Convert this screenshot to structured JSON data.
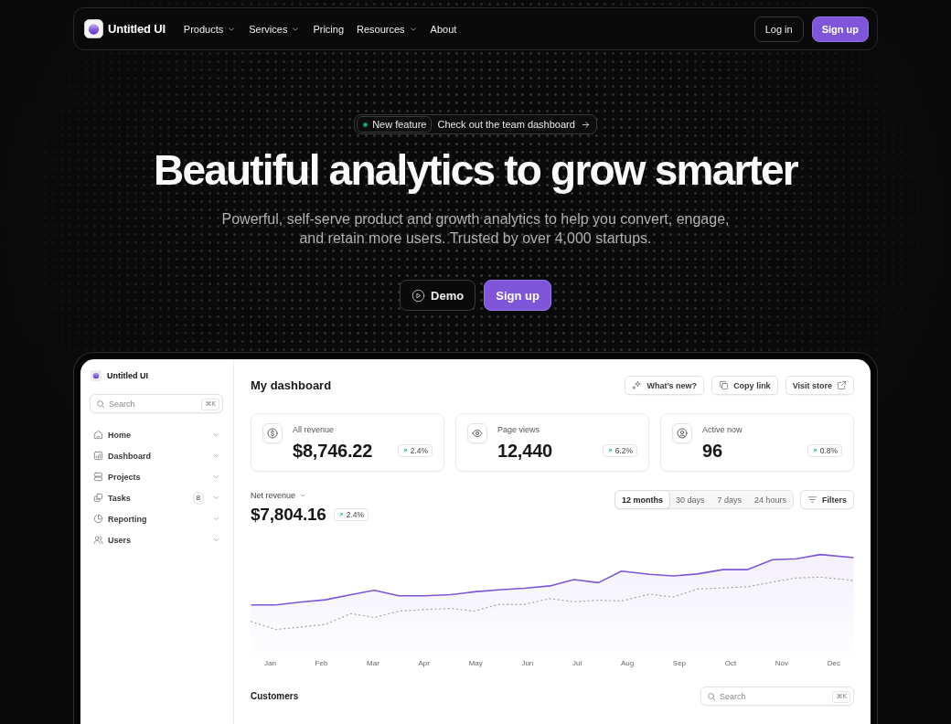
{
  "nav": {
    "brand": "Untitled UI",
    "links": [
      {
        "label": "Products",
        "kind": "dropdown"
      },
      {
        "label": "Services",
        "kind": "dropdown"
      },
      {
        "label": "Pricing",
        "kind": "link"
      },
      {
        "label": "Resources",
        "kind": "dropdown"
      },
      {
        "label": "About",
        "kind": "link"
      }
    ],
    "login": "Log in",
    "signup": "Sign up"
  },
  "hero": {
    "announcement": {
      "tag": "New feature",
      "text": "Check out the team dashboard"
    },
    "title": "Beautiful analytics to grow smarter",
    "subtitle": "Powerful, self-serve product and growth analytics to help you convert, engage, and retain more users. Trusted by over 4,000 startups.",
    "buttons": [
      {
        "label": "Demo",
        "kind": "secondary"
      },
      {
        "label": "Sign up",
        "kind": "primary"
      }
    ]
  },
  "dashboard": {
    "sidebar": {
      "brand": "Untitled UI",
      "search": {
        "placeholder": "Search",
        "shortcut": "⌘K"
      },
      "items": [
        {
          "label": "Home"
        },
        {
          "label": "Dashboard"
        },
        {
          "label": "Projects"
        },
        {
          "label": "Tasks",
          "badge": "8"
        },
        {
          "label": "Reporting"
        },
        {
          "label": "Users"
        }
      ]
    },
    "title": "My dashboard",
    "actions": [
      {
        "label": "What’s new?"
      },
      {
        "label": "Copy link"
      },
      {
        "label": "Visit store"
      }
    ],
    "stats": [
      {
        "label": "All revenue",
        "value": "$8,746.22",
        "change": "2.4%"
      },
      {
        "label": "Page views",
        "value": "12,440",
        "change": "6.2%"
      },
      {
        "label": "Active now",
        "value": "96",
        "change": "0.8%"
      }
    ],
    "revenue": {
      "label": "Net revenue",
      "value": "$7,804.16",
      "change": "2.4%",
      "ranges": [
        {
          "label": "12 months",
          "selected": true
        },
        {
          "label": "30 days",
          "selected": false
        },
        {
          "label": "7 days",
          "selected": false
        },
        {
          "label": "24 hours",
          "selected": false
        }
      ],
      "filters": "Filters",
      "chart": {
        "x_labels": [
          "Jan",
          "Feb",
          "Mar",
          "Apr",
          "May",
          "Jun",
          "Jul",
          "Aug",
          "Sep",
          "Oct",
          "Nov",
          "Dec"
        ]
      }
    },
    "customers": {
      "title": "Customers",
      "search": {
        "placeholder": "Search",
        "shortcut": "⌘K"
      }
    }
  }
}
